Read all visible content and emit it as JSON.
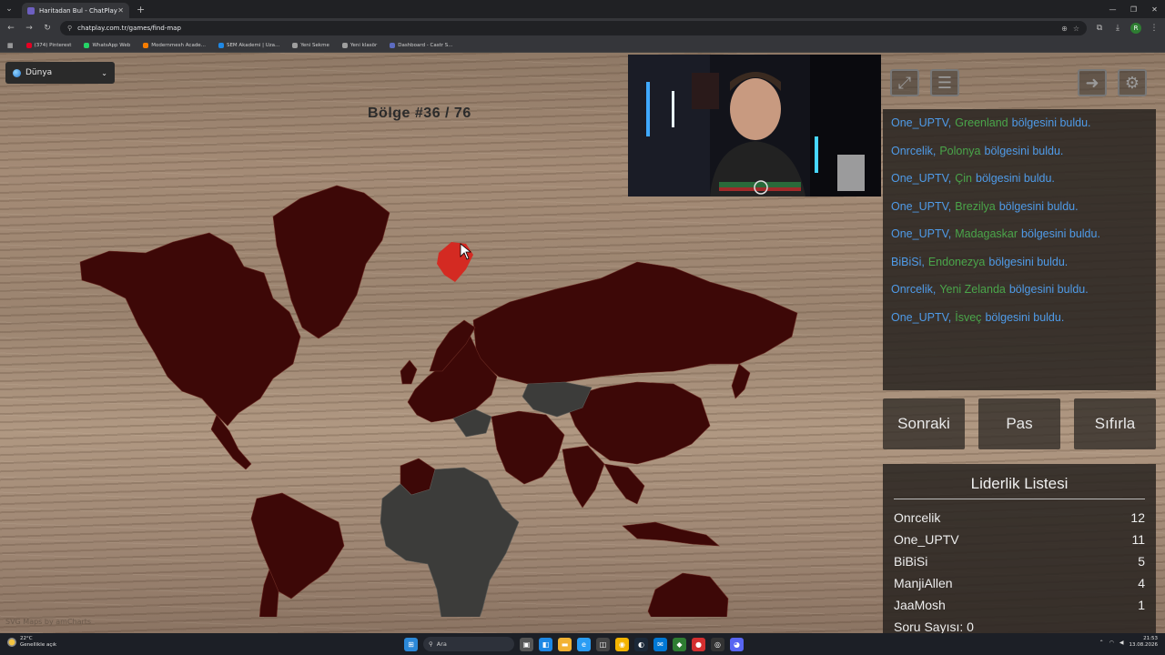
{
  "browser": {
    "tab_title": "Haritadan Bul - ChatPlay",
    "url": "chatplay.com.tr/games/find-map",
    "bookmarks": [
      {
        "label": "(374) Pinterest",
        "color": "#e60023"
      },
      {
        "label": "WhatsApp Web",
        "color": "#25d366"
      },
      {
        "label": "Modernmesh Acade...",
        "color": "#f57c00"
      },
      {
        "label": "SEM Akademi | Uza...",
        "color": "#1e88e5"
      },
      {
        "label": "Yeni Sekme",
        "color": "#9e9e9e"
      },
      {
        "label": "Yeni klasör",
        "color": "#9e9e9e"
      },
      {
        "label": "Dashboard - Castr S...",
        "color": "#5c6bc0"
      }
    ],
    "profile_initial": "R"
  },
  "game": {
    "region_select": "Dünya",
    "region_counter": "Bölge #36 / 76",
    "map_credit": "SVG Maps by amCharts"
  },
  "feed": [
    {
      "user": "One_UPTV,",
      "country": "Greenland",
      "suffix": "bölgesini buldu."
    },
    {
      "user": "Onrcelik,",
      "country": "Polonya",
      "suffix": "bölgesini buldu."
    },
    {
      "user": "One_UPTV,",
      "country": "Çin",
      "suffix": "bölgesini buldu."
    },
    {
      "user": "One_UPTV,",
      "country": "Brezilya",
      "suffix": "bölgesini buldu."
    },
    {
      "user": "One_UPTV,",
      "country": "Madagaskar",
      "suffix": "bölgesini buldu."
    },
    {
      "user": "BiBiSi,",
      "country": "Endonezya",
      "suffix": "bölgesini buldu."
    },
    {
      "user": "Onrcelik,",
      "country": "Yeni Zelanda",
      "suffix": "bölgesini buldu."
    },
    {
      "user": "One_UPTV,",
      "country": "İsveç",
      "suffix": "bölgesini buldu."
    }
  ],
  "actions": {
    "next": "Sonraki",
    "pass": "Pas",
    "reset": "Sıfırla"
  },
  "leaderboard": {
    "title": "Liderlik Listesi",
    "rows": [
      {
        "name": "Onrcelik",
        "score": "12"
      },
      {
        "name": "One_UPTV",
        "score": "11"
      },
      {
        "name": "BiBiSi",
        "score": "5"
      },
      {
        "name": "ManjiAllen",
        "score": "4"
      },
      {
        "name": "JaaMosh",
        "score": "1"
      }
    ],
    "question_count": "Soru Sayısı: 0"
  },
  "taskbar": {
    "weather_temp": "22°C",
    "weather_desc": "Genellikle açık",
    "search_placeholder": "Ara",
    "time": "21:53",
    "date": "13.08.2026"
  },
  "colors": {
    "found_country": "#3d0807",
    "unfound_country": "#3c3c3a",
    "highlight_region": "#d42a22",
    "feed_user": "#4f9be8",
    "feed_country": "#4aa54a"
  }
}
